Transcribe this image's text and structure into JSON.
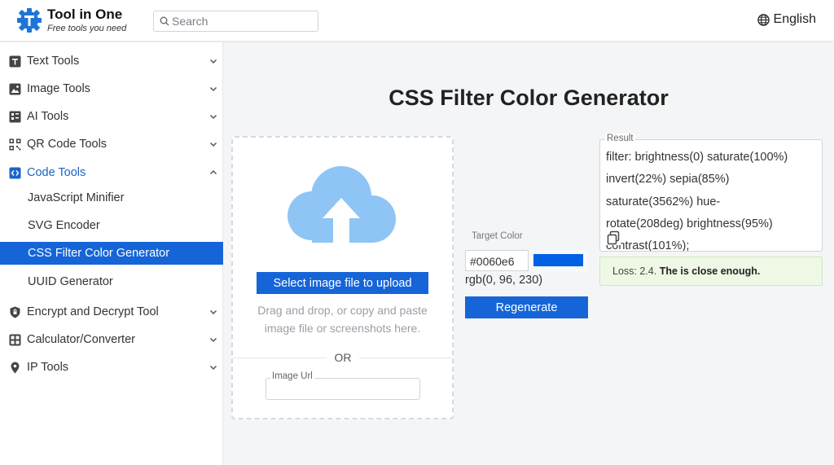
{
  "header": {
    "brand_name": "Tool in One",
    "brand_tagline": "Free tools you need",
    "search_placeholder": "Search",
    "language": "English"
  },
  "sidebar": {
    "items": [
      {
        "label": "Text Tools",
        "icon": "text-icon"
      },
      {
        "label": "Image Tools",
        "icon": "image-icon"
      },
      {
        "label": "AI Tools",
        "icon": "ai-icon"
      },
      {
        "label": "QR Code Tools",
        "icon": "qr-code-icon"
      },
      {
        "label": "Code Tools",
        "icon": "code-icon",
        "expanded": true
      },
      {
        "label": "Encrypt and Decrypt Tool",
        "icon": "shield-icon"
      },
      {
        "label": "Calculator/Converter",
        "icon": "calculator-icon"
      },
      {
        "label": "IP Tools",
        "icon": "location-pin-icon"
      }
    ],
    "subitems": [
      {
        "label": "JavaScript Minifier"
      },
      {
        "label": "SVG Encoder"
      },
      {
        "label": "CSS Filter Color Generator",
        "active": true
      },
      {
        "label": "UUID Generator"
      }
    ]
  },
  "main": {
    "title": "CSS Filter Color Generator",
    "upload": {
      "button_label": "Select image file to upload",
      "hint": "Drag and drop, or copy and paste\nimage file or screenshots here.",
      "or_text": "OR",
      "url_label": "Image Url"
    },
    "target": {
      "label": "Target Color",
      "hex": "#0060e6",
      "rgb": "rgb(0, 96, 230)",
      "swatch_color": "#0060e6",
      "regenerate_label": "Regenerate"
    },
    "result": {
      "label": "Result",
      "text": "filter: brightness(0) saturate(100%)\ninvert(22%) sepia(85%)\nsaturate(3562%) hue-\nrotate(208deg) brightness(95%)\ncontrast(101%);",
      "loss_prefix": "Loss: 2.4.",
      "loss_message": "The is close enough."
    }
  },
  "colors": {
    "accent": "#1565d8",
    "loss_bg": "#eef8e5",
    "cloud": "#8ec5f4"
  }
}
